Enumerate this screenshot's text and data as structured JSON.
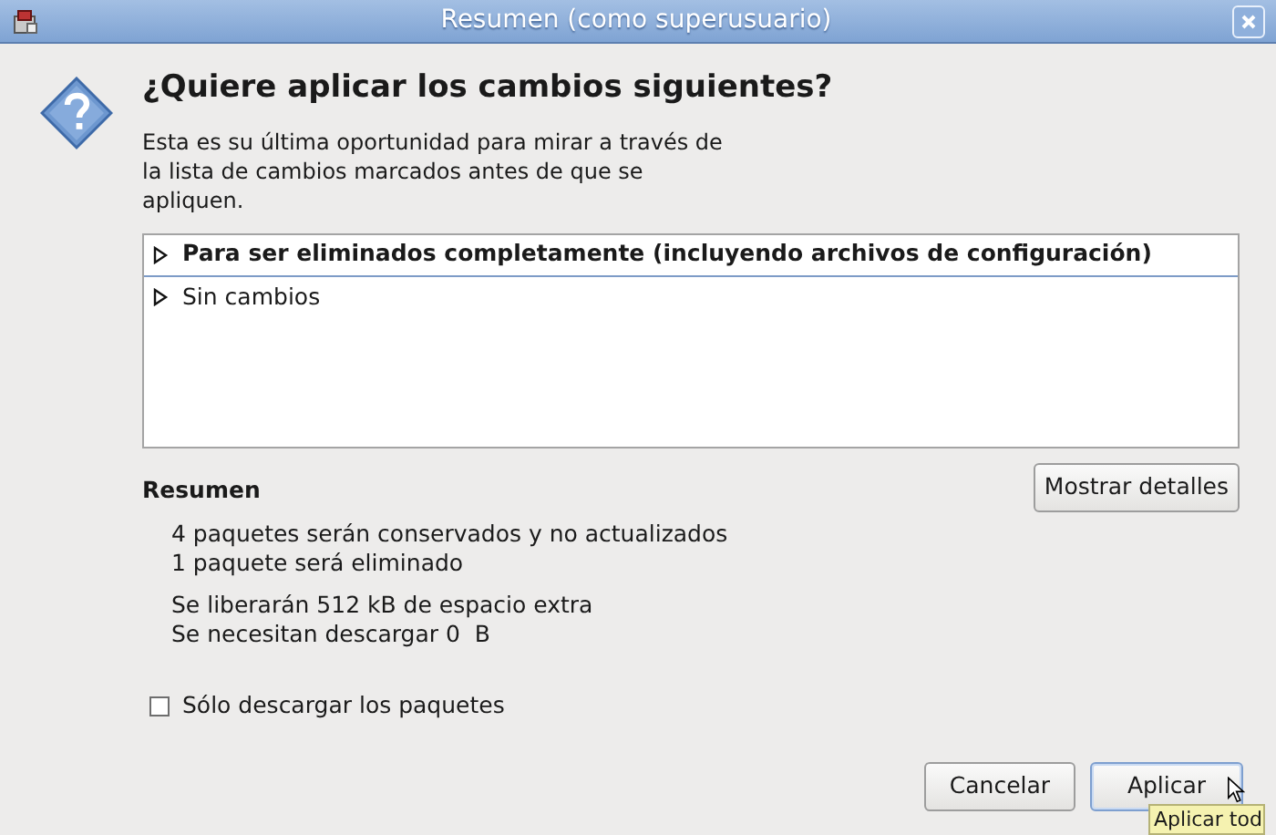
{
  "window": {
    "title": "Resumen (como superusuario)"
  },
  "heading": "¿Quiere aplicar los cambios siguientes?",
  "description": "Esta es su última oportunidad para mirar a través de la lista de cambios marcados antes de que se apliquen.",
  "changes": [
    {
      "label": "Para ser eliminados completamente (incluyendo archivos de configuración)",
      "selected": true,
      "expanded": false
    },
    {
      "label": "Sin cambios",
      "selected": false,
      "expanded": false
    }
  ],
  "summary": {
    "title": "Resumen",
    "details_button": "Mostrar detalles",
    "groups": [
      [
        "4 paquetes serán conservados y no actualizados",
        "1 paquete será eliminado"
      ],
      [
        "Se liberarán 512 kB de espacio extra",
        "Se necesitan descargar 0  B"
      ]
    ]
  },
  "download_only": {
    "label": "Sólo descargar los paquetes",
    "checked": false
  },
  "buttons": [
    {
      "label": "Cancelar",
      "focused": false
    },
    {
      "label": "Aplicar",
      "focused": true
    }
  ],
  "tooltip": "Aplicar tod"
}
